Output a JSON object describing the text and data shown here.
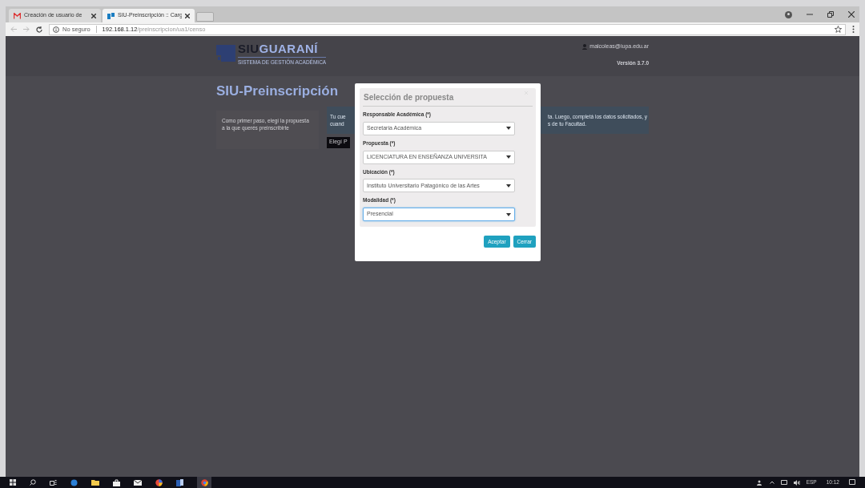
{
  "browser": {
    "tabs": [
      {
        "title": "Creación de usuario de",
        "selected": false
      },
      {
        "title": "SIU-Preinscripción :: Carg",
        "selected": true
      }
    ],
    "security": "No seguro",
    "url_host": "192.168.1.12",
    "url_path": "/preinscripcion/ua1/censo"
  },
  "header": {
    "logo_strong": "SIU",
    "logo_light": "GUARANÍ",
    "logo_subtitle": "SISTEMA DE GESTIÓN ACADÉMICA",
    "user": "malcoleas@iupa.edu.ar",
    "version": "Versión 3.7.0"
  },
  "page": {
    "title": "SIU-Preinscripción",
    "intro": "Como primer paso, elegí la propuesta a la que querés preinscribirte",
    "info_left": [
      "Tu cue",
      "cuand"
    ],
    "info_right": [
      "ta. Luego, completá los datos solicitados, y",
      "s de tu Facultad."
    ],
    "choose_button": "Elegí P"
  },
  "modal": {
    "title": "Selección de propuesta",
    "fields": [
      {
        "label": "Responsable Académica (*)",
        "value": "Secretaria Académica",
        "focused": false
      },
      {
        "label": "Propuesta (*)",
        "value": "LICENCIATURA EN ENSEÑANZA UNIVERSITA",
        "focused": false
      },
      {
        "label": "Ubicación (*)",
        "value": "Instituto Universitario Patagónico de las Artes",
        "focused": false
      },
      {
        "label": "Modalidad (*)",
        "value": "Presencial",
        "focused": true
      }
    ],
    "buttons": [
      "Aceptar",
      "Cerrar"
    ]
  },
  "taskbar": {
    "language": "ESP",
    "time": "10:12"
  }
}
